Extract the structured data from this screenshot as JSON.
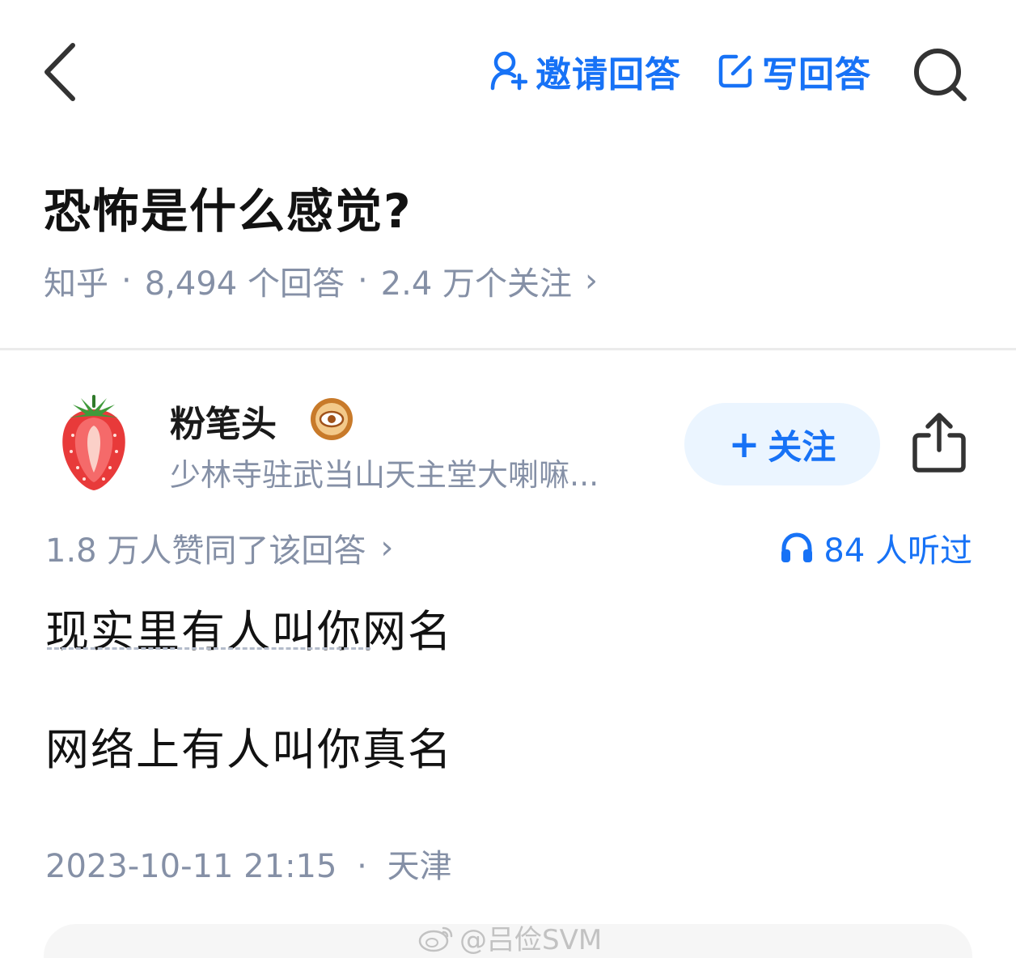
{
  "header": {
    "invite_label": "邀请回答",
    "write_label": "写回答",
    "accent_color": "#1772f6"
  },
  "question": {
    "title": "恐怖是什么感觉?",
    "source": "知乎",
    "answers": "8,494 个回答",
    "followers": "2.4 万个关注",
    "separator": "·",
    "chevron": "›"
  },
  "answer": {
    "author_name": "粉笔头",
    "author_bio": "少林寺驻武当山天主堂大喇嘛...",
    "follow_plus": "+",
    "follow_label": "关注",
    "votes": "1.8 万人赞同了该回答",
    "listen": "84 人听过",
    "line1": "现实里有人叫你网名",
    "line2": "网络上有人叫你真名",
    "date": "2023-10-11 21:15",
    "location": "天津"
  },
  "watermark": {
    "text": "@吕俭SVM",
    "icon": "weibo-icon"
  },
  "icons": [
    "back-arrow-icon",
    "add-user-icon",
    "edit-icon",
    "search-icon",
    "badge-eye-icon",
    "share-icon",
    "headphones-icon",
    "strawberry-avatar"
  ]
}
